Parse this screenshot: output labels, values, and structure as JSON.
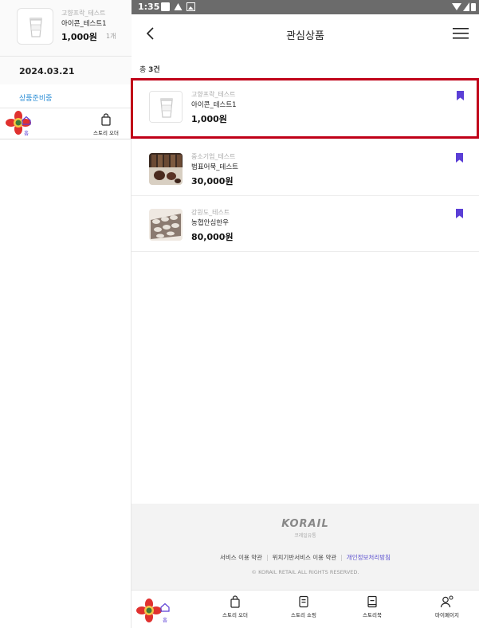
{
  "left_panel": {
    "card": {
      "seller": "고향프락_테스트",
      "name": "아이콘_테스트1",
      "price": "1,000원",
      "qty": "1개"
    },
    "date": "2024.03.21",
    "status": "상품준비중",
    "bottom_bar": {
      "home": "홈",
      "story_order": "스토리 오더"
    }
  },
  "status_bar": {
    "time": "1:35"
  },
  "app_bar": {
    "title": "관심상품"
  },
  "list": {
    "count_prefix": "총",
    "count_value": "3건",
    "items": [
      {
        "seller": "고향프락_테스트",
        "name": "아이콘_테스트1",
        "price": "1,000원",
        "thumb": "coffee-cup"
      },
      {
        "seller": "중소기업_테스트",
        "name": "범표어묵_테스트",
        "price": "30,000원",
        "thumb": "tea-set"
      },
      {
        "seller": "강원도_테스트",
        "name": "농협안심한우",
        "price": "80,000원",
        "thumb": "sliced-meat"
      }
    ]
  },
  "footer": {
    "logo_text": "KORAIL",
    "logo_sub": "코레일유통",
    "links": [
      "서비스 이용 약관",
      "위치기반서비스 이용 약관",
      "개인정보처리방침"
    ],
    "copyright": "© KORAIL RETAIL ALL RIGHTS RESERVED."
  },
  "tab_bar": [
    {
      "label": "홈",
      "icon": "home-icon"
    },
    {
      "label": "스토리 오더",
      "icon": "bag-icon"
    },
    {
      "label": "스토리 쇼핑",
      "icon": "shopping-icon"
    },
    {
      "label": "스토리북",
      "icon": "book-icon"
    },
    {
      "label": "마이페이지",
      "icon": "user-icon"
    }
  ],
  "colors": {
    "accent": "#5b3fd6",
    "selection_border": "#c00018",
    "status_blue": "#2e8fd6",
    "statusbar": "#6b6b6b"
  }
}
